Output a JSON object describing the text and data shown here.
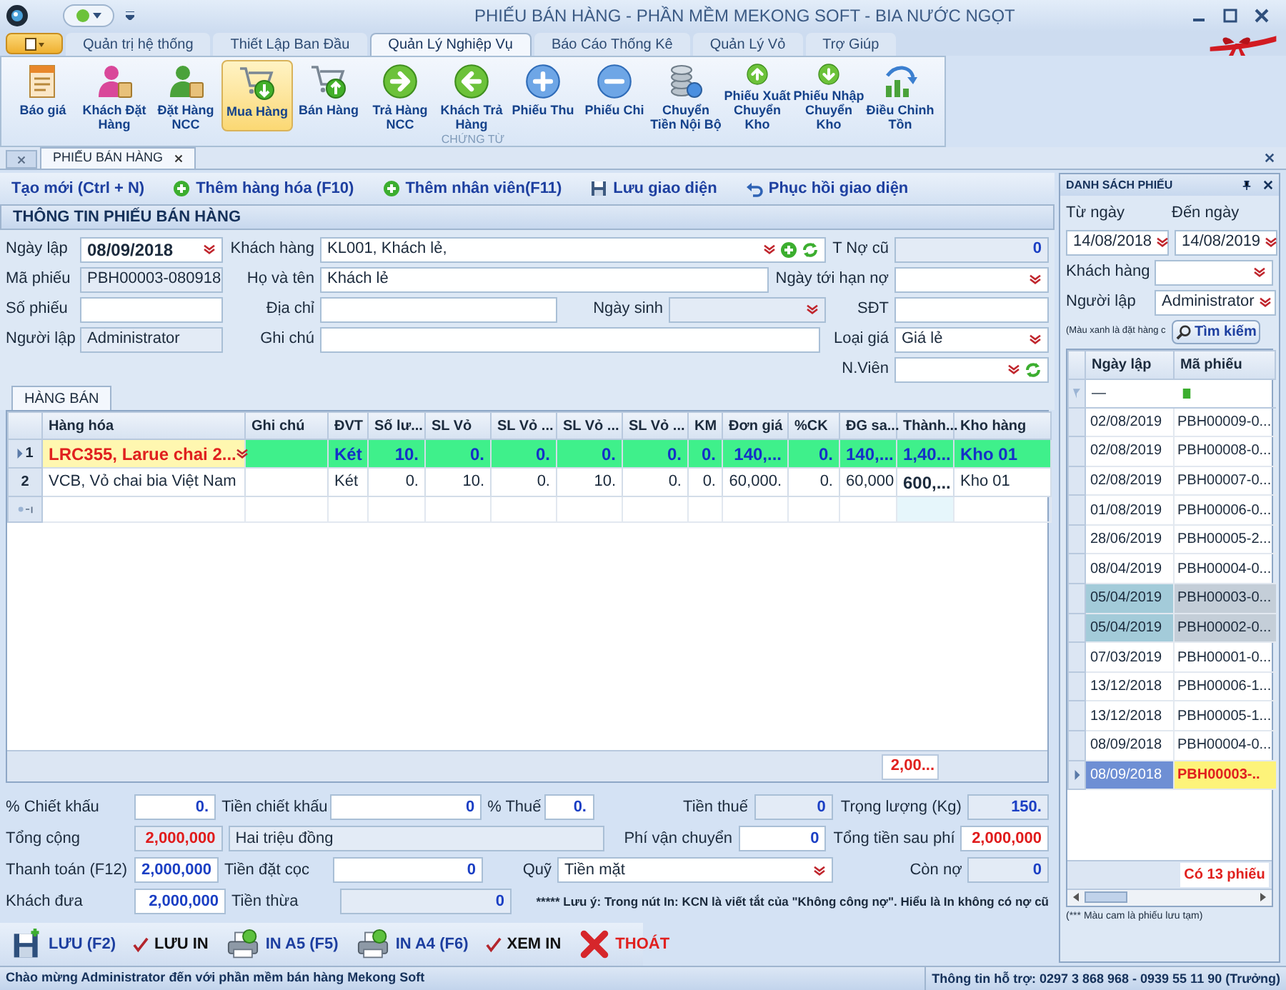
{
  "window": {
    "title": "PHIẾU BÁN HÀNG - PHẦN MỀM MEKONG SOFT - BIA NƯỚC NGỌT"
  },
  "ribbon_tabs": [
    {
      "label": "Quản trị hệ thống",
      "selected": false
    },
    {
      "label": "Thiết Lập Ban Đầu",
      "selected": false
    },
    {
      "label": "Quản Lý Nghiệp Vụ",
      "selected": true
    },
    {
      "label": "Báo Cáo Thống Kê",
      "selected": false
    },
    {
      "label": "Quản Lý Vỏ",
      "selected": false
    },
    {
      "label": "Trợ Giúp",
      "selected": false
    }
  ],
  "ribbon_buttons": [
    {
      "label": "Báo giá",
      "kind": "quote",
      "selected": false
    },
    {
      "label": "Khách Đặt Hàng",
      "kind": "customer",
      "selected": false
    },
    {
      "label": "Đặt Hàng NCC",
      "kind": "supplier",
      "selected": false
    },
    {
      "label": "Mua Hàng",
      "kind": "cart-in",
      "selected": true
    },
    {
      "label": "Bán Hàng",
      "kind": "cart-out",
      "selected": false
    },
    {
      "label": "Trả Hàng NCC",
      "kind": "right",
      "selected": false
    },
    {
      "label": "Khách Trả Hàng",
      "kind": "left",
      "selected": false
    },
    {
      "label": "Phiếu Thu",
      "kind": "plus",
      "selected": false
    },
    {
      "label": "Phiếu Chi",
      "kind": "minus",
      "selected": false
    },
    {
      "label": "Chuyển Tiền Nội Bộ",
      "kind": "coins",
      "selected": false
    },
    {
      "label": "Phiếu Xuất Chuyển Kho",
      "kind": "up",
      "selected": false
    },
    {
      "label": "Phiếu Nhập Chuyển Kho",
      "kind": "down",
      "selected": false
    },
    {
      "label": "Điều Chỉnh Tồn",
      "kind": "chart",
      "selected": false
    }
  ],
  "ribbon_group": "CHỨNG TỪ",
  "document_tab": "PHIẾU BÁN HÀNG",
  "toolbar": [
    {
      "label": "Tạo mới (Ctrl + N)",
      "kind": "new"
    },
    {
      "label": "Thêm hàng hóa (F10)",
      "kind": "add"
    },
    {
      "label": "Thêm nhân viên(F11)",
      "kind": "add"
    },
    {
      "label": "Lưu giao diện",
      "kind": "save"
    },
    {
      "label": "Phục hồi giao diện",
      "kind": "restore"
    }
  ],
  "form": {
    "title": "THÔNG TIN PHIẾU BÁN HÀNG",
    "created_date": {
      "label": "Ngày lập",
      "value": "08/09/2018",
      "kind": "dropdown"
    },
    "customer": {
      "label": "Khách hàng",
      "value": "KL001, Khách lẻ,",
      "kind": "dropdown",
      "add": true,
      "refresh": true
    },
    "old_debt": {
      "label": "T Nợ cũ",
      "value": "0",
      "kind": "readonly"
    },
    "voucher_code": {
      "label": "Mã phiếu",
      "value": "PBH00003-080918",
      "kind": "readonly"
    },
    "full_name": {
      "label": "Họ và tên",
      "value": "Khách lẻ",
      "kind": "text"
    },
    "due_date": {
      "label": "Ngày tới hạn nợ",
      "kind": "dropdown"
    },
    "voucher_no": {
      "label": "Số phiếu",
      "kind": "text"
    },
    "address": {
      "label": "Địa chỉ",
      "kind": "text"
    },
    "birth_date": {
      "label": "Ngày sinh",
      "kind": "readonly_dropdown"
    },
    "phone": {
      "label": "SĐT",
      "kind": "text"
    },
    "creator": {
      "label": "Người lập",
      "value": "Administrator",
      "kind": "readonly"
    },
    "note": {
      "label": "Ghi chú",
      "kind": "text"
    },
    "price_type": {
      "label": "Loại giá",
      "value": "Giá lẻ",
      "kind": "dropdown"
    },
    "staff": {
      "label": "N.Viên",
      "kind": "dropdown",
      "refresh": true
    }
  },
  "grid_tab": "HÀNG BÁN",
  "table": {
    "columns": [
      "Hàng hóa",
      "Ghi chú",
      "ĐVT",
      "Số lư...",
      "SL Vỏ",
      "SL Vỏ ...",
      "SL Vỏ ...",
      "SL Vỏ ...",
      "KM",
      "Đơn giá",
      "%CK",
      "ĐG sa...",
      "Thành...",
      "Kho hàng"
    ],
    "rows": [
      {
        "number": "1",
        "selected": true,
        "cells": [
          "LRC355, Larue chai 2...",
          null,
          "Két",
          "10.",
          "0.",
          "0.",
          "0.",
          "0.",
          "0.",
          "140,...",
          "0.",
          "140,...",
          "1,40...",
          "Kho 01"
        ]
      },
      {
        "number": "2",
        "selected": false,
        "cells": [
          "VCB, Vỏ chai bia Việt Nam",
          null,
          "Két",
          "0.",
          "10.",
          "0.",
          "10.",
          "0.",
          "0.",
          "60,000.",
          "0.",
          "60,000",
          "600,...",
          "Kho 01"
        ]
      }
    ],
    "total": "2,00..."
  },
  "summary": {
    "discount_pct": {
      "label": "% Chiết khấu",
      "value": "0.",
      "kind": "text"
    },
    "discount_amount": {
      "label": "Tiền chiết khấu",
      "value": "0",
      "kind": "text"
    },
    "tax_pct": {
      "label": "% Thuế",
      "value": "0.",
      "kind": "text"
    },
    "tax_amount": {
      "label": "Tiền thuế",
      "value": "0",
      "kind": "readonly"
    },
    "weight": {
      "label": "Trọng lượng (Kg)",
      "value": "150.",
      "kind": "readonly"
    },
    "total": {
      "label": "Tổng cộng",
      "value": "2,000,000",
      "kind": "readonly"
    },
    "total_words": {
      "value": "Hai triệu đồng",
      "kind": "readonly"
    },
    "shipping": {
      "label": "Phí vận chuyển",
      "value": "0",
      "kind": "text"
    },
    "grand_total": {
      "label": "Tổng tiền sau phí",
      "value": "2,000,000",
      "kind": "text"
    },
    "payment": {
      "label": "Thanh toán (F12)",
      "value": "2,000,000",
      "kind": "text"
    },
    "deposit": {
      "label": "Tiền đặt cọc",
      "value": "0",
      "kind": "text"
    },
    "fund": {
      "label": "Quỹ",
      "value": "Tiền mặt",
      "kind": "dropdown"
    },
    "remaining": {
      "label": "Còn nợ",
      "value": "0",
      "kind": "readonly"
    },
    "given": {
      "label": "Khách đưa",
      "value": "2,000,000",
      "kind": "text"
    },
    "change": {
      "label": "Tiền thừa",
      "value": "0",
      "kind": "readonly"
    },
    "print_note": "***** Lưu ý: Trong nút In: KCN là viết tắt của \"Không công nợ\". Hiểu là In không có nợ cũ"
  },
  "actions": [
    {
      "label": "LƯU (F2)",
      "kind": "save"
    },
    {
      "label": "LƯU IN",
      "kind": "check"
    },
    {
      "label": "IN A5 (F5)",
      "kind": "print"
    },
    {
      "label": "IN A4 (F6)",
      "kind": "print"
    },
    {
      "label": "XEM IN",
      "kind": "check"
    },
    {
      "label": "THOÁT",
      "kind": "exit"
    }
  ],
  "list_panel": {
    "title": "DANH SÁCH PHIẾU",
    "from_label": "Từ ngày",
    "to_label": "Đến ngày",
    "from": "14/08/2018",
    "to": "14/08/2019",
    "customer_label": "Khách hàng",
    "creator_label": "Người lập",
    "creator": "Administrator",
    "hint": "(Màu xanh là đặt hàng c",
    "search": "Tìm kiếm",
    "columns": [
      "Ngày lập",
      "Mã phiếu"
    ],
    "filter": "—",
    "rows": [
      {
        "date": "02/08/2019",
        "code": "PBH00009-0...",
        "highlighted": false,
        "selected": false
      },
      {
        "date": "02/08/2019",
        "code": "PBH00008-0...",
        "highlighted": false,
        "selected": false
      },
      {
        "date": "02/08/2019",
        "code": "PBH00007-0...",
        "highlighted": false,
        "selected": false
      },
      {
        "date": "01/08/2019",
        "code": "PBH00006-0...",
        "highlighted": false,
        "selected": false
      },
      {
        "date": "28/06/2019",
        "code": "PBH00005-2...",
        "highlighted": false,
        "selected": false
      },
      {
        "date": "08/04/2019",
        "code": "PBH00004-0...",
        "highlighted": false,
        "selected": false
      },
      {
        "date": "05/04/2019",
        "code": "PBH00003-0...",
        "highlighted": true,
        "selected": false
      },
      {
        "date": "05/04/2019",
        "code": "PBH00002-0...",
        "highlighted": true,
        "selected": false
      },
      {
        "date": "07/03/2019",
        "code": "PBH00001-0...",
        "highlighted": false,
        "selected": false
      },
      {
        "date": "13/12/2018",
        "code": "PBH00006-1...",
        "highlighted": false,
        "selected": false
      },
      {
        "date": "13/12/2018",
        "code": "PBH00005-1...",
        "highlighted": false,
        "selected": false
      },
      {
        "date": "08/09/2018",
        "code": "PBH00004-0...",
        "highlighted": false,
        "selected": false
      },
      {
        "date": "08/09/2018",
        "code": "PBH00003-..",
        "highlighted": false,
        "selected": true
      }
    ],
    "count": "Có 13 phiếu",
    "legend": "(*** Màu cam là phiếu lưu tạm)"
  },
  "status_bar": {
    "welcome": "Chào mừng Administrator đến với phần mềm bán hàng Mekong Soft",
    "support": "Thông tin hỗ trợ: 0297 3 868 968 - 0939 55 11 90 (Trưởng)"
  }
}
